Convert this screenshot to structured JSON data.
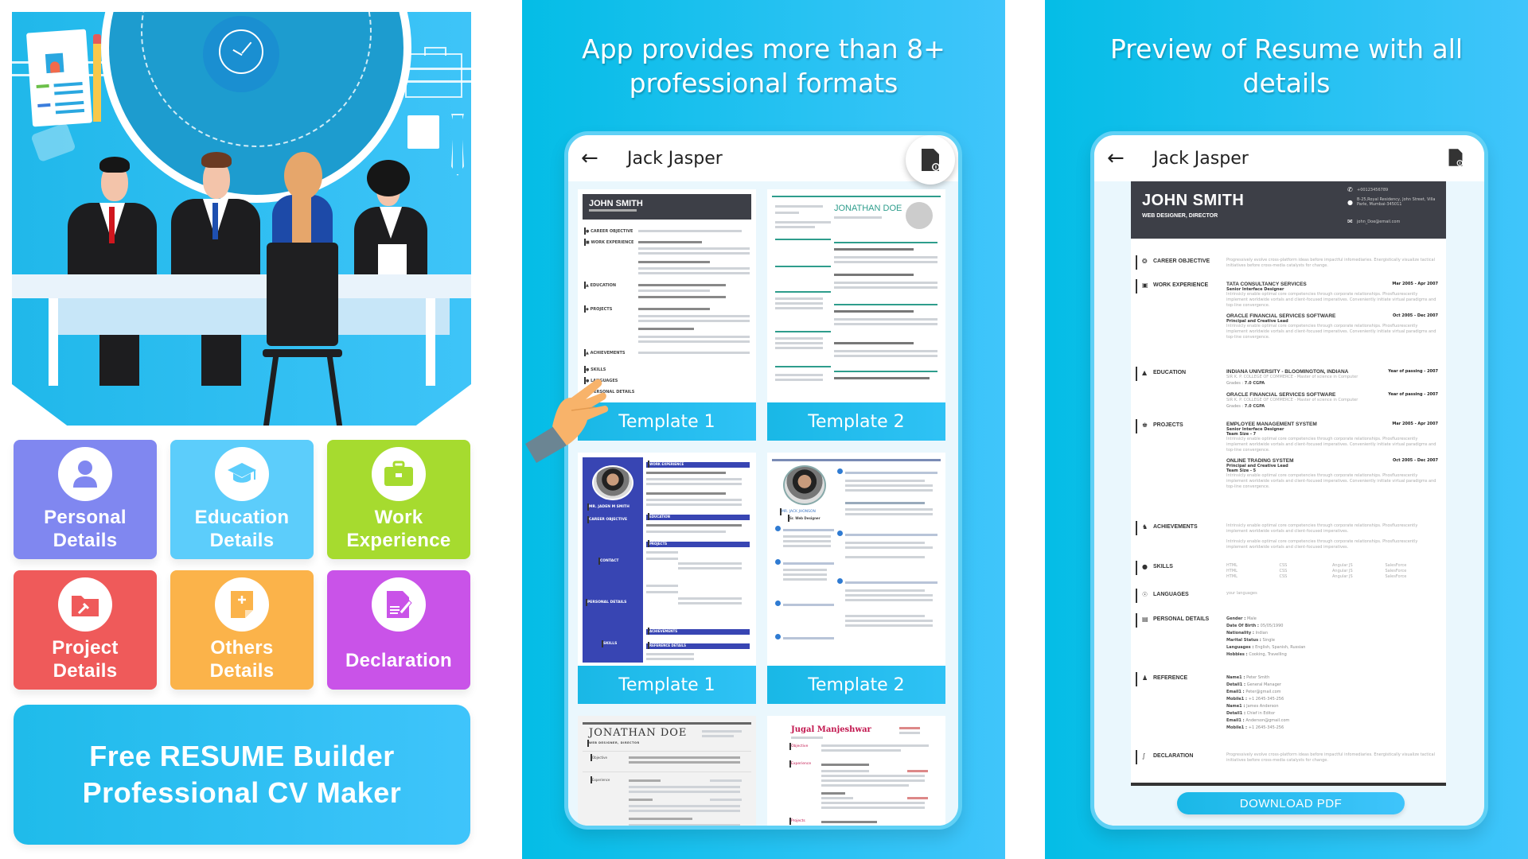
{
  "left_panel": {
    "tiles": [
      {
        "label_line1": "Personal",
        "label_line2": "Details",
        "icon": "user-icon",
        "color": "#8087f0"
      },
      {
        "label_line1": "Education",
        "label_line2": "Details",
        "icon": "graduation-cap-icon",
        "color": "#5ccdfb"
      },
      {
        "label_line1": "Work",
        "label_line2": "Experience",
        "icon": "briefcase-icon",
        "color": "#a6db2f"
      },
      {
        "label_line1": "Project",
        "label_line2": "Details",
        "icon": "project-folder-icon",
        "color": "#ef5a5a"
      },
      {
        "label_line1": "Others",
        "label_line2": "Details",
        "icon": "add-document-icon",
        "color": "#fbb34a"
      },
      {
        "label_line1": "Declaration",
        "label_line2": "",
        "icon": "signature-document-icon",
        "color": "#c953e8"
      }
    ],
    "banner": {
      "line1": "Free RESUME Builder",
      "line2": "Professional CV Maker"
    }
  },
  "middle_panel": {
    "headline_line1": "App provides more than 8+",
    "headline_line2": "professional formats",
    "app_bar": {
      "back_icon": "arrow-left-icon",
      "title": "Jack Jasper",
      "action_icon": "pdf-file-icon"
    },
    "templates": [
      {
        "label": "Template 1",
        "resume_name": "JOHN SMITH",
        "style": "dark-header"
      },
      {
        "label": "Template 2",
        "resume_name": "JONATHAN DOE",
        "style": "teal"
      },
      {
        "label": "Template 1",
        "resume_name": "MR. JADEN M SMITH",
        "style": "blue-sidebar",
        "sidebar_sections": [
          "CAREER OBJECTIVE",
          "CONTACT",
          "PERSONAL DETAILS",
          "SKILLS"
        ],
        "main_sections": [
          "WORK EXPERIENCE",
          "EDUCATION",
          "PROJECTS",
          "ACHIEVEMENTS",
          "REFERENCE DETAILS"
        ]
      },
      {
        "label": "Template 2",
        "resume_name": "MR. JACK JHONSON",
        "resume_role": "Sr. Web Designer",
        "style": "blue-circles"
      },
      {
        "label": "",
        "resume_name": "JONATHAN DOE",
        "resume_role": "WEB DESIGNER, DIRECTOR",
        "style": "serif",
        "sections": [
          "Objective",
          "Experience"
        ]
      },
      {
        "label": "",
        "resume_name": "Jugal Manjeshwar",
        "style": "red-serif",
        "sections": [
          "Objective",
          "Experience",
          "Projects"
        ]
      }
    ]
  },
  "right_panel": {
    "headline_line1": "Preview of Resume with all",
    "headline_line2": "details",
    "app_bar": {
      "back_icon": "arrow-left-icon",
      "title": "Jack Jasper",
      "action_icon": "pdf-file-icon"
    },
    "resume": {
      "name": "JOHN SMITH",
      "role": "WEB DESIGNER, DIRECTOR",
      "contact": {
        "phone": "+00123456789",
        "address": "B-25,Royal Residency, John Street, Villa Parle, Mumbai-345011",
        "email": "john_Doe@email.com"
      },
      "sections": {
        "career_objective": {
          "title": "CAREER OBJECTIVE",
          "text": "Progressively evolve cross-platform ideas before impactful infomediaries. Energistically visualize tactical initiatives before cross-media catalysts for change."
        },
        "work_experience": {
          "title": "WORK EXPERIENCE",
          "entries": [
            {
              "org": "TATA CONSULTANCY SERVICES",
              "position": "Senior Interface Designer",
              "date": "Mar 2005 - Apr 2007",
              "text": "Intrinsicly enable optimal core competencies through corporate relationships. Phosfluorescently implement worldwide vortals and client-focused imperatives. Conveniently initiate virtual paradigms and top-line convergence."
            },
            {
              "org": "ORACLE FINANCIAL SERVICES SOFTWARE",
              "position": "Principal and Creative Lead",
              "date": "Oct 2005 - Dec 2007",
              "text": "Intrinsicly enable optimal core competencies through corporate relationships. Phosfluorescently implement worldwide vortals and client-focused imperatives. Conveniently initiate virtual paradigms and top-line convergence."
            }
          ]
        },
        "education": {
          "title": "EDUCATION",
          "entries": [
            {
              "org": "INDIANA UNIVERSITY - BLOOMINGTON, INDIANA",
              "date": "Year of passing - 2007",
              "detail": "SIR K. P. COLLEGE OF COMMERCE - Master of science in Computer",
              "grade_label": "Grades :",
              "grade": "7.0 CGPA"
            },
            {
              "org": "ORACLE FINANCIAL SERVICES SOFTWARE",
              "date": "Year of passing - 2007",
              "detail": "SIR K. P. COLLEGE OF COMMERCE - Master of science in Computer",
              "grade_label": "Grades :",
              "grade": "7.0 CGPA"
            }
          ]
        },
        "projects": {
          "title": "PROJECTS",
          "entries": [
            {
              "org": "EMPLOYEE MANAGEMENT SYSTEM",
              "position": "Senior Interface Designer",
              "team": "Team Size - 7",
              "date": "Mar 2005 - Apr 2007",
              "text": "Intrinsicly enable optimal core competencies through corporate relationships. Phosfluorescently implement worldwide vortals and client-focused imperatives. Conveniently initiate virtual paradigms and top-line convergence."
            },
            {
              "org": "ONLINE TRADING SYSTEM",
              "position": "Principal and Creative Lead",
              "team": "Team Size - 5",
              "date": "Oct 2005 - Dec 2007",
              "text": "Intrinsicly enable optimal core competencies through corporate relationships. Phosfluorescently implement worldwide vortals and client-focused imperatives. Conveniently initiate virtual paradigms and top-line convergence."
            }
          ]
        },
        "achievements": {
          "title": "ACHIEVEMENTS",
          "items": [
            "Intrinsicly enable optimal core competencies through corporate relationships. Phosfluorescently implement worldwide vortals and client-focused imperatives.",
            "Intrinsicly enable optimal core competencies through corporate relationships. Phosfluorescently implement worldwide vortals and client-focused imperatives."
          ]
        },
        "skills": {
          "title": "SKILLS",
          "items": [
            "HTML",
            "CSS",
            "Angular JS",
            "SalesForce",
            "HTML",
            "CSS",
            "Angular JS",
            "SalesForce",
            "HTML",
            "CSS",
            "Angular JS",
            "SalesForce"
          ]
        },
        "languages": {
          "title": "LANGUAGES",
          "text": "your languages"
        },
        "personal_details": {
          "title": "PERSONAL DETAILS",
          "rows": [
            {
              "k": "Gender",
              "v": "Male"
            },
            {
              "k": "Date Of Birth",
              "v": "05/05/1990"
            },
            {
              "k": "Nationality",
              "v": "Indian"
            },
            {
              "k": "Marital Status",
              "v": "Single"
            },
            {
              "k": "Languages",
              "v": "English, Spanish, Russian"
            },
            {
              "k": "Hobbies",
              "v": "Cooking, Travelling"
            }
          ]
        },
        "reference": {
          "title": "REFERENCE",
          "rows": [
            {
              "k": "Name1",
              "v": "Peter Smith"
            },
            {
              "k": "Detail1",
              "v": "General Manager"
            },
            {
              "k": "Email1",
              "v": "Peter@gmail.com"
            },
            {
              "k": "Mobile1",
              "v": "+1 2645-345-256"
            },
            {
              "k": "Name1",
              "v": "James Anderson"
            },
            {
              "k": "Detail1",
              "v": "Chief in Editor"
            },
            {
              "k": "Email1",
              "v": "Anderson@gmail.com"
            },
            {
              "k": "Mobile1",
              "v": "+1 2645-345-256"
            }
          ]
        },
        "declaration": {
          "title": "DECLARATION",
          "text": "Progressively evolve cross-platform ideas before impactful infomediaries. Energistically visualize tactical initiatives before cross-media catalysts for change."
        }
      }
    },
    "download_button": "DOWNLOAD PDF"
  }
}
